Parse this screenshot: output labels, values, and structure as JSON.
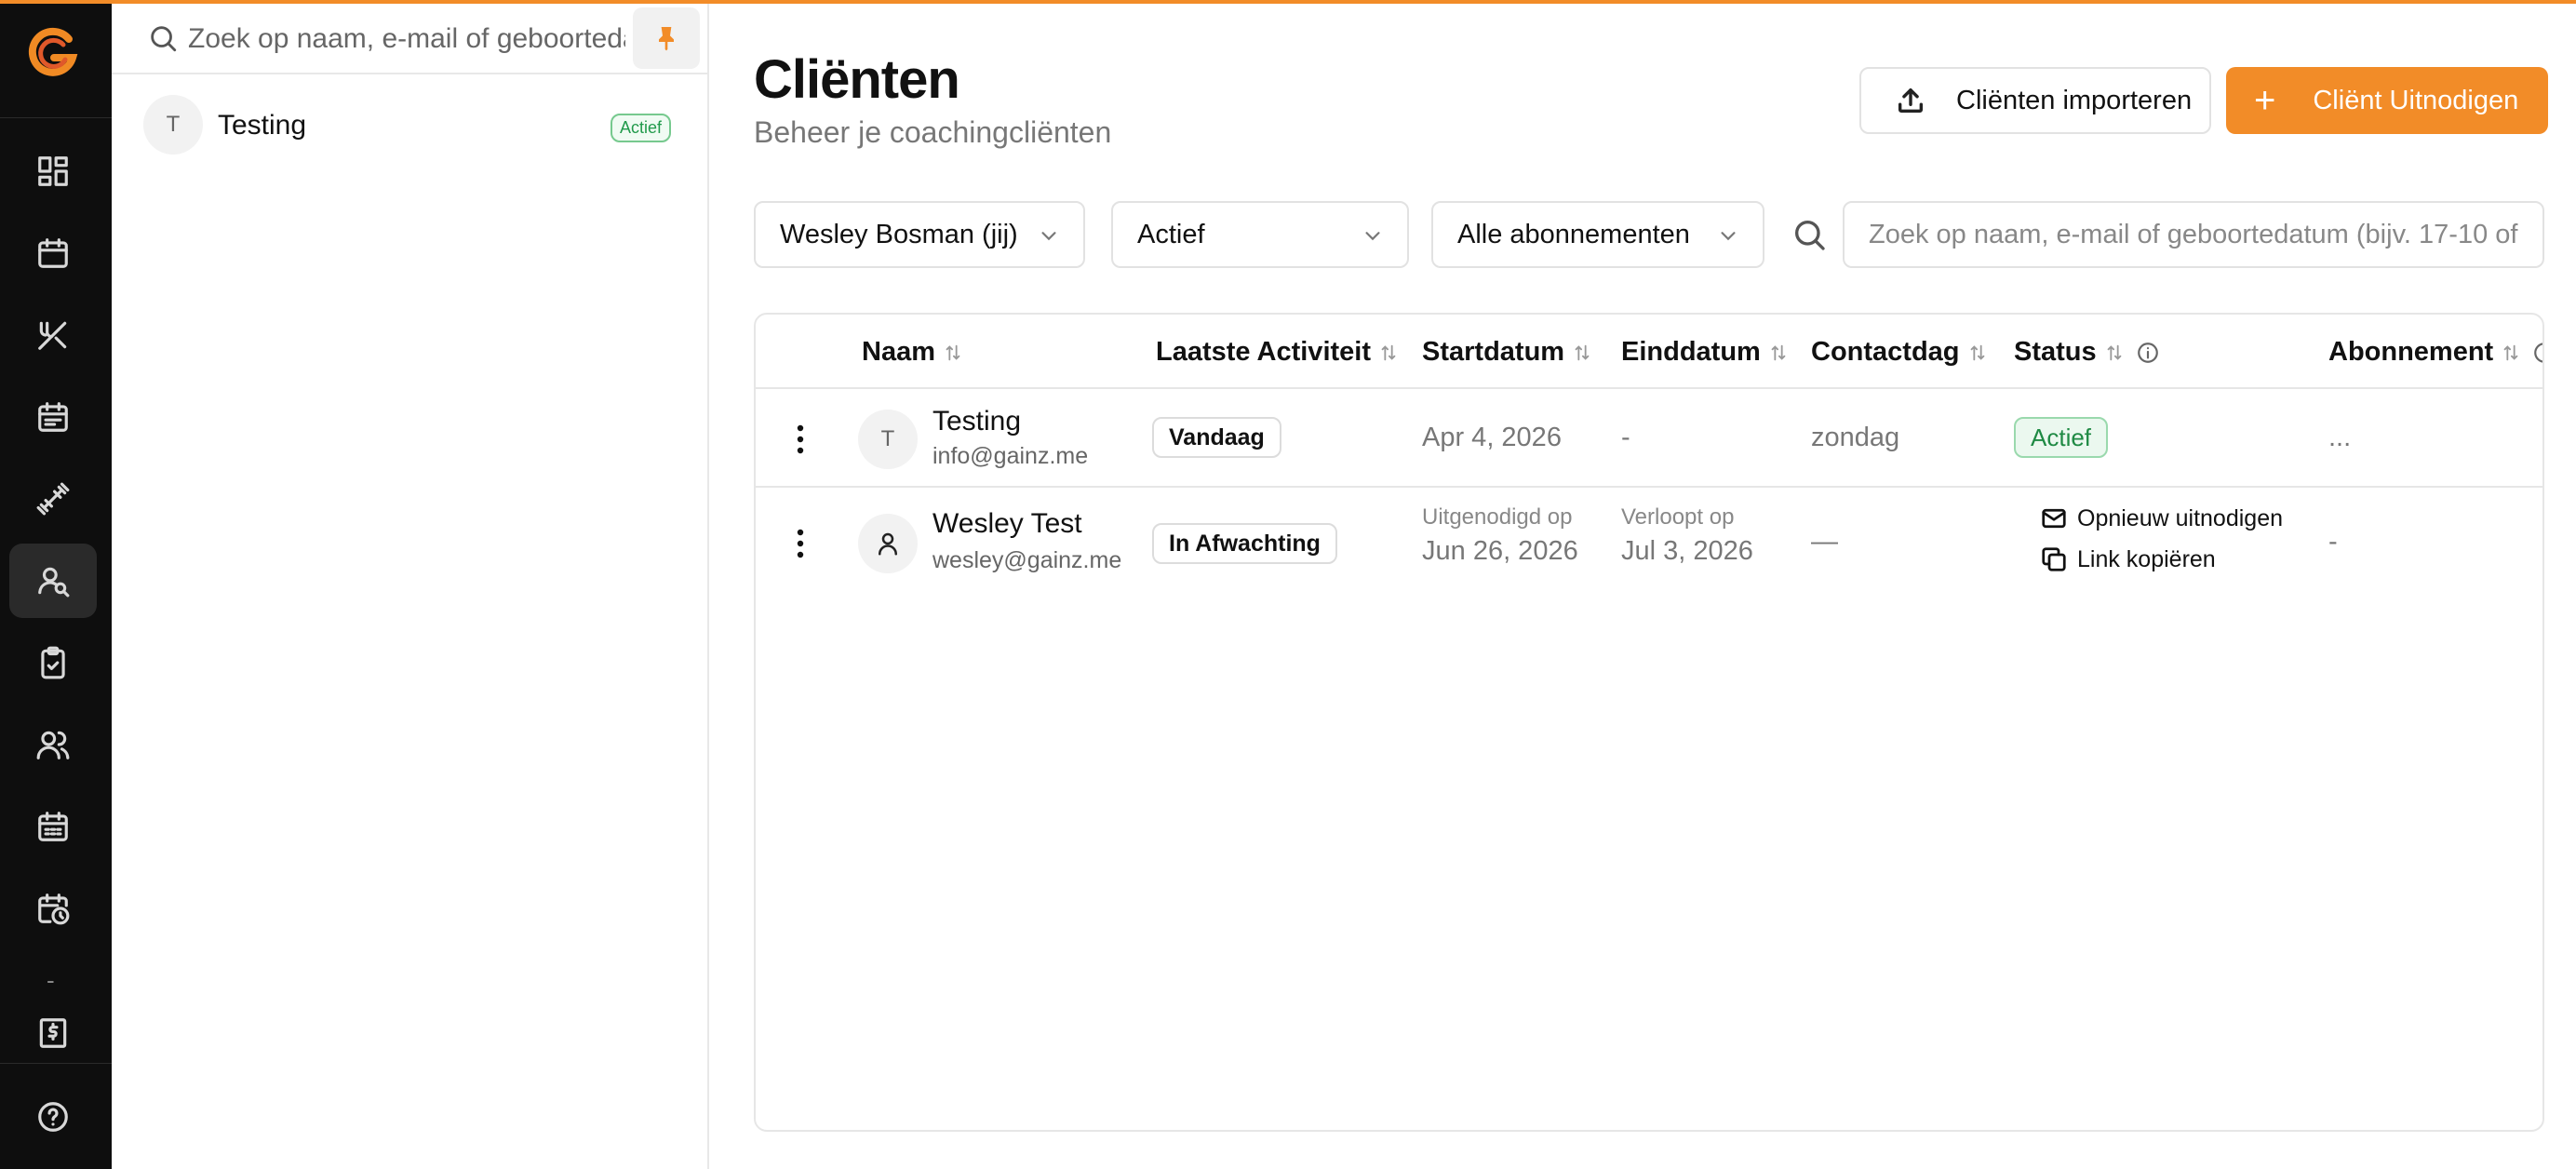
{
  "sidebar_nav": [
    "dashboard-icon",
    "calendar-icon",
    "nutrition-icon",
    "schedule-icon",
    "workout-icon",
    "clients-icon",
    "checklist-icon",
    "team-icon",
    "planner-icon",
    "calendar-clock-icon",
    "invoice-icon",
    "help-icon"
  ],
  "sidebar_dash": "-",
  "client_list": {
    "search_placeholder": "Zoek op naam, e-mail of geboortedatum",
    "items": [
      {
        "initial": "T",
        "name": "Testing",
        "badge": "Actief"
      }
    ]
  },
  "header": {
    "title": "Cliënten",
    "subtitle": "Beheer je coachingcliënten",
    "import_label": "Cliënten importeren",
    "invite_label": "Cliënt Uitnodigen",
    "invite_plus": "+"
  },
  "filters": {
    "coach": "Wesley Bosman (jij)",
    "status": "Actief",
    "subscription": "Alle abonnementen",
    "search_placeholder": "Zoek op naam, e-mail of geboortedatum (bijv. 17-10 of"
  },
  "table": {
    "columns": [
      "Naam",
      "Laatste Activiteit",
      "Startdatum",
      "Einddatum",
      "Contactdag",
      "Status",
      "Abonnement"
    ],
    "rows": [
      {
        "initial": "T",
        "name": "Testing",
        "email": "info@gainz.me",
        "activity": "Vandaag",
        "start": "Apr 4, 2026",
        "end": "-",
        "contact_day": "zondag",
        "status": "Actief",
        "subscription": "..."
      },
      {
        "name": "Wesley Test",
        "email": "wesley@gainz.me",
        "activity": "In Afwachting",
        "start_label": "Uitgenodigd op",
        "start": "Jun 26, 2026",
        "end_label": "Verloopt op",
        "end": "Jul 3, 2026",
        "contact_day": "—",
        "action_reinvite": "Opnieuw uitnodigen",
        "action_copy": "Link kopiëren",
        "subscription": "-"
      }
    ]
  },
  "colors": {
    "accent": "#f28c28",
    "rail": "#0e0e0e",
    "status_green": "#1f8a44"
  }
}
